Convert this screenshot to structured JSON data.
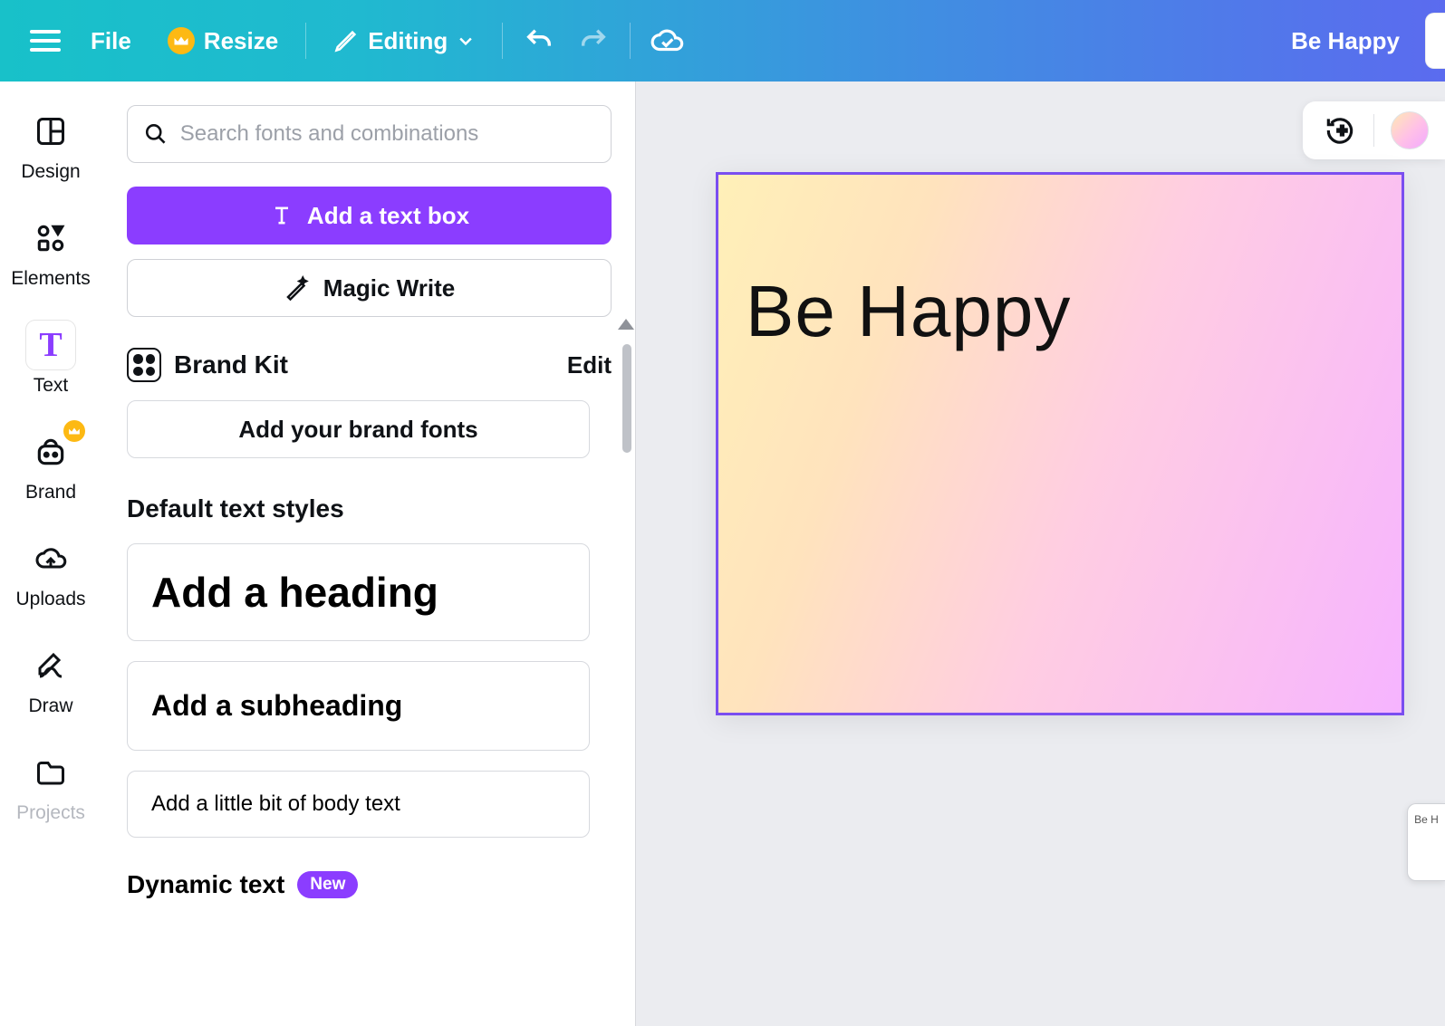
{
  "toolbar": {
    "file_label": "File",
    "resize_label": "Resize",
    "editing_label": "Editing",
    "document_title": "Be Happy"
  },
  "nav": {
    "items": [
      {
        "id": "design",
        "label": "Design"
      },
      {
        "id": "elements",
        "label": "Elements"
      },
      {
        "id": "text",
        "label": "Text"
      },
      {
        "id": "brand",
        "label": "Brand"
      },
      {
        "id": "uploads",
        "label": "Uploads"
      },
      {
        "id": "draw",
        "label": "Draw"
      },
      {
        "id": "projects",
        "label": "Projects"
      }
    ]
  },
  "panel": {
    "search_placeholder": "Search fonts and combinations",
    "add_text_box_label": "Add a text box",
    "magic_write_label": "Magic Write",
    "brand_kit_label": "Brand Kit",
    "edit_label": "Edit",
    "add_brand_fonts_label": "Add your brand fonts",
    "default_text_styles_label": "Default text styles",
    "heading_card_label": "Add a heading",
    "subheading_card_label": "Add a subheading",
    "body_card_label": "Add a little bit of body text",
    "dynamic_text_label": "Dynamic text",
    "new_badge_label": "New"
  },
  "canvas": {
    "text_content": "Be Happy",
    "mini_preview_text": "Be H",
    "selection_color": "#7a4ef0",
    "gradient_colors": [
      "#fff0b8",
      "#ffe3bd",
      "#ffcde2",
      "#f6b4ff"
    ]
  },
  "colors": {
    "accent_purple": "#8b3dff",
    "toolbar_gradient_start": "#18C1C9",
    "toolbar_gradient_end": "#5B6BEF",
    "crown_badge": "#FDB913"
  }
}
